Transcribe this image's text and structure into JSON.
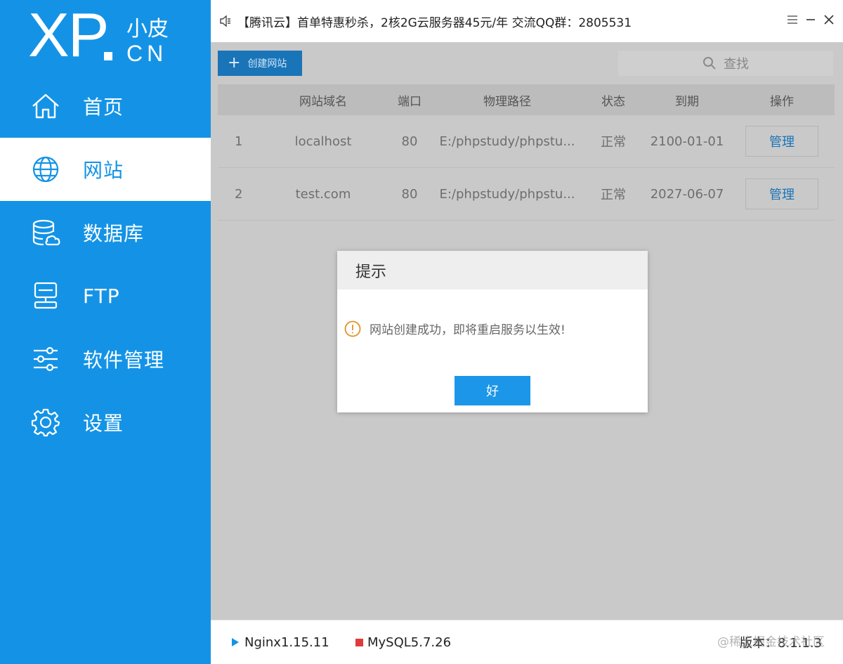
{
  "brand": {
    "logo_main": "XP",
    "logo_cn_top": "小皮",
    "logo_cn_bottom": "CN"
  },
  "sidebar": {
    "items": [
      {
        "label": "首页",
        "icon": "home-icon",
        "active": false
      },
      {
        "label": "网站",
        "icon": "globe-icon",
        "active": true
      },
      {
        "label": "数据库",
        "icon": "database-icon",
        "active": false
      },
      {
        "label": "FTP",
        "icon": "ftp-monitor-icon",
        "active": false
      },
      {
        "label": "软件管理",
        "icon": "sliders-icon",
        "active": false
      },
      {
        "label": "设置",
        "icon": "gear-icon",
        "active": false
      }
    ]
  },
  "titlebar": {
    "announcement": "【腾讯云】首单特惠秒杀，2核2G云服务器45元/年 交流QQ群：2805531"
  },
  "toolbar": {
    "create_label": "创建网站",
    "search_label": "查找"
  },
  "table": {
    "headers": [
      "网站域名",
      "端口",
      "物理路径",
      "状态",
      "到期",
      "操作"
    ],
    "rows": [
      {
        "idx": "1",
        "domain": "localhost",
        "port": "80",
        "path": "E:/phpstudy/phpstu...",
        "status": "正常",
        "expires": "2100-01-01",
        "action": "管理"
      },
      {
        "idx": "2",
        "domain": "test.com",
        "port": "80",
        "path": "E:/phpstudy/phpstu...",
        "status": "正常",
        "expires": "2027-06-07",
        "action": "管理"
      }
    ]
  },
  "dialog": {
    "title": "提示",
    "message": "网站创建成功，即将重启服务以生效!",
    "ok_label": "好"
  },
  "footer": {
    "nginx": "Nginx1.15.11",
    "mysql": "MySQL5.7.26",
    "version": "版本：8.1.1.3",
    "watermark": "@稀土掘金技术社区"
  },
  "colors": {
    "brand_blue": "#1493e6",
    "button_dark_blue": "#1a74b8",
    "mysql_red": "#e03b3b"
  }
}
